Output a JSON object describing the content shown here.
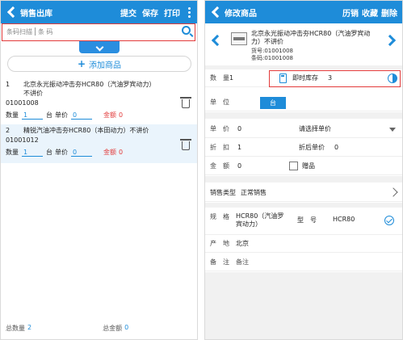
{
  "left": {
    "title": "销售出库",
    "actions": [
      "提交",
      "保存",
      "打印"
    ],
    "search": {
      "scan_label": "条码扫描",
      "placeholder": "条 码"
    },
    "add_button": "添加商品",
    "items": [
      {
        "index": "1",
        "name": "北京永光振动冲击夯HCR80（汽油罗宾动力）不讲价",
        "code": "01001008",
        "qty_label": "数量",
        "qty": "1",
        "unit": "台",
        "price_label": "单价",
        "price": "0",
        "amount_label": "金额",
        "amount": "0"
      },
      {
        "index": "2",
        "name": "精锐汽油冲击夯HCR80（本田动力）不讲价",
        "code": "01001012",
        "qty_label": "数量",
        "qty": "1",
        "unit": "台",
        "price_label": "单价",
        "price": "0",
        "amount_label": "金额",
        "amount": "0"
      }
    ],
    "footer": {
      "total_qty_label": "总数量",
      "total_qty": "2",
      "total_amount_label": "总金额",
      "total_amount": "0"
    }
  },
  "right": {
    "title": "修改商品",
    "actions": [
      "历销",
      "收藏",
      "删除"
    ],
    "product": {
      "name": "北京永光振动冲击夯HCR80（汽油罗宾动力）不讲价",
      "model_no": "货号:01001008",
      "barcode": "条码:01001008"
    },
    "fields": {
      "qty_label": "数量",
      "qty": "1",
      "stock_label": "即时库存",
      "stock": "3",
      "unit_label": "单位",
      "unit": "台",
      "price_label": "单价",
      "price": "0",
      "price_select": "请选择单价",
      "discount_label": "折扣",
      "discount": "1",
      "discount_price_label": "折后单价",
      "discount_price": "0",
      "amount_label": "金额",
      "amount": "0",
      "gift_label": "赠品",
      "sale_type_label": "销售类型",
      "sale_type": "正常销售",
      "spec_label": "规格",
      "spec": "HCR80（汽油罗宾动力）",
      "model_label": "型号",
      "model": "HCR80",
      "origin_label": "产地",
      "origin": "北京",
      "note_label": "备注",
      "note": "备注"
    }
  },
  "colors": {
    "accent": "#1e8cd9",
    "alert": "#e23b3b"
  }
}
